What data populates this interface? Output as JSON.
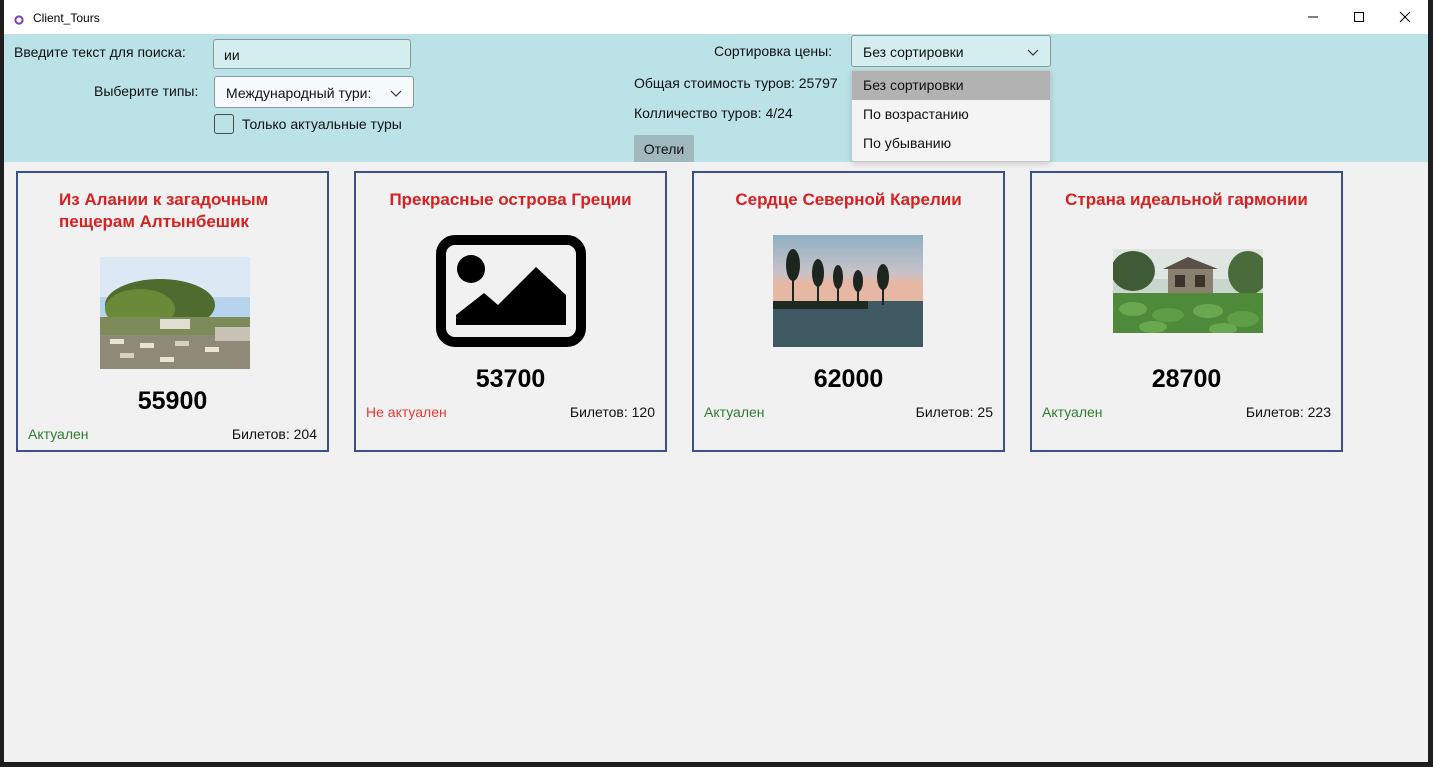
{
  "window": {
    "title": "Client_Tours"
  },
  "filters": {
    "search_label": "Введите текст для поиска:",
    "search_value": "ии",
    "types_label": "Выберите типы:",
    "types_value": "Международный тури:",
    "actual_only_label": "Только актуальные туры",
    "actual_only_checked": false
  },
  "sorting": {
    "label": "Сортировка цены:",
    "selected": "Без сортировки",
    "options": [
      "Без сортировки",
      "По возрастанию",
      "По убыванию"
    ],
    "dropdown_open": true
  },
  "stats": {
    "total_cost": "Общая стоимость туров: 25797",
    "count": "Колличество туров: 4/24"
  },
  "buttons": {
    "hotels": "Отели"
  },
  "colors": {
    "toolbar_bg": "#bbe2e6",
    "title_red": "#d92020",
    "actual_green": "#2e7d32",
    "inactive_red": "#e53935",
    "card_border": "#3c4f8f"
  },
  "tours": [
    {
      "title": "Из Алании к загадочным пещерам Алтынбешик",
      "price": "55900",
      "status": "Актуален",
      "actual": true,
      "tickets": "Билетов: 204",
      "image": "beach-photo"
    },
    {
      "title": "Прекрасные острова Греции",
      "price": "53700",
      "status": "Не актуален",
      "actual": false,
      "tickets": "Билетов: 120",
      "image": "image-placeholder-icon"
    },
    {
      "title": "Сердце Северной Карелии",
      "price": "62000",
      "status": "Актуален",
      "actual": true,
      "tickets": "Билетов: 25",
      "image": "lake-sunset-photo"
    },
    {
      "title": "Страна идеальной гармонии",
      "price": "28700",
      "status": "Актуален",
      "actual": true,
      "tickets": "Билетов: 223",
      "image": "garden-pond-photo"
    }
  ]
}
